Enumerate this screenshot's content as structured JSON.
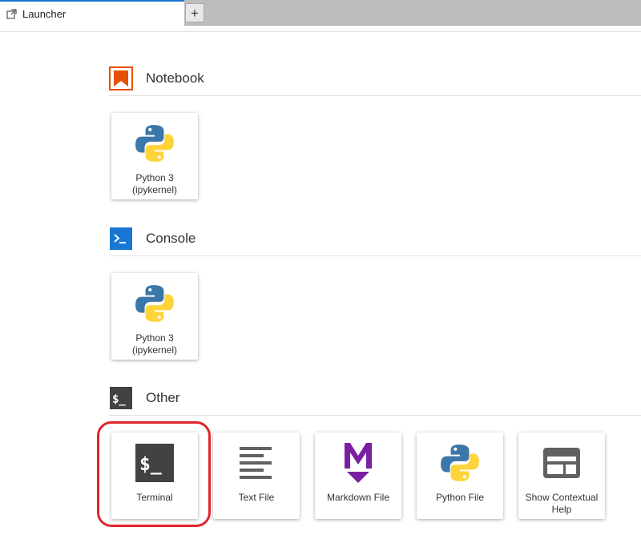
{
  "tab": {
    "label": "Launcher",
    "add_label": "+"
  },
  "sections": {
    "notebook": {
      "title": "Notebook",
      "items": [
        {
          "label": "Python 3 (ipykernel)"
        }
      ]
    },
    "console": {
      "title": "Console",
      "items": [
        {
          "label": "Python 3 (ipykernel)"
        }
      ]
    },
    "other": {
      "title": "Other",
      "items": [
        {
          "label": "Terminal"
        },
        {
          "label": "Text File"
        },
        {
          "label": "Markdown File"
        },
        {
          "label": "Python File"
        },
        {
          "label": "Show Contextual Help"
        }
      ]
    }
  },
  "icons": {
    "tab": "external-launch-icon",
    "notebook": "notebook-bookmark-icon",
    "console": "console-prompt-icon",
    "other": "terminal-icon",
    "python": "python-logo-icon",
    "text_file": "text-lines-icon",
    "markdown": "markdown-m-icon",
    "help": "contextual-help-icon"
  },
  "colors": {
    "notebook_orange": "#e65100",
    "console_blue": "#1976d2",
    "markdown_purple": "#7b1fa2",
    "highlight_red": "#e0262b",
    "python_blue": "#3b77a8",
    "python_yellow": "#ffd43b"
  }
}
